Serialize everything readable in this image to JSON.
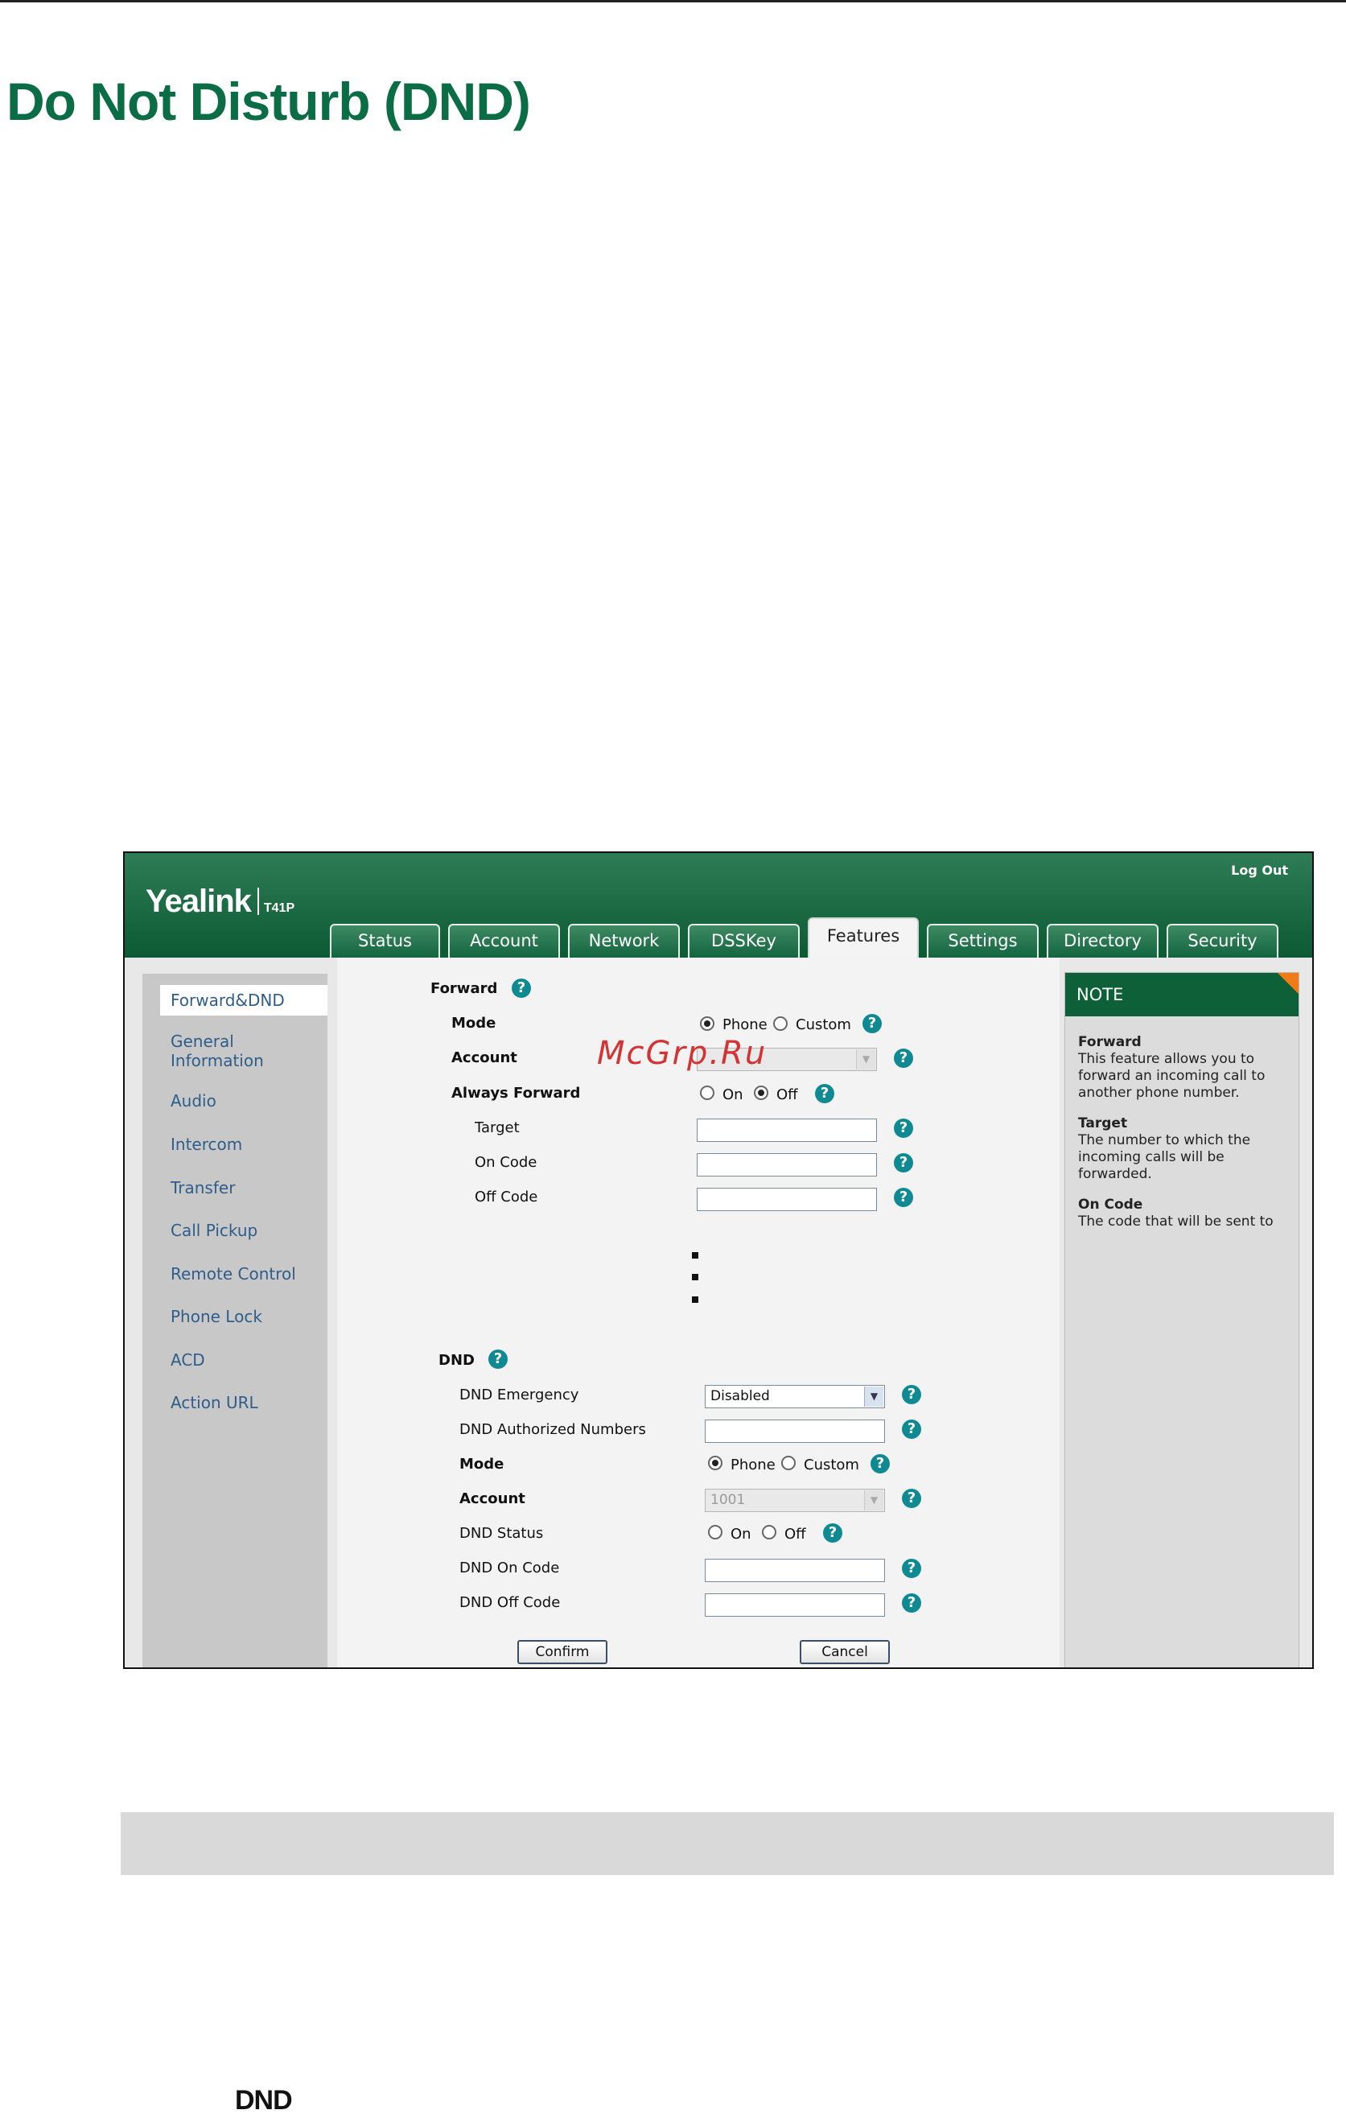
{
  "page": {
    "title": "Do Not Disturb (DND)",
    "bottom_text": "DND"
  },
  "app": {
    "brand": "Yealink",
    "model": "T41P",
    "logout": "Log Out",
    "tabs": [
      "Status",
      "Account",
      "Network",
      "DSSKey",
      "Features",
      "Settings",
      "Directory",
      "Security"
    ],
    "active_tab": "Features"
  },
  "sidebar": {
    "items": [
      "Forward&DND",
      "General Information",
      "Audio",
      "Intercom",
      "Transfer",
      "Call Pickup",
      "Remote Control",
      "Phone Lock",
      "ACD",
      "Action URL"
    ],
    "active": "Forward&DND"
  },
  "forward": {
    "section": "Forward",
    "mode_label": "Mode",
    "mode_phone": "Phone",
    "mode_custom": "Custom",
    "account_label": "Account",
    "always_forward_label": "Always Forward",
    "on": "On",
    "off": "Off",
    "target_label": "Target",
    "on_code_label": "On Code",
    "off_code_label": "Off Code"
  },
  "dnd": {
    "section": "DND",
    "emergency_label": "DND Emergency",
    "emergency_value": "Disabled",
    "authorized_label": "DND Authorized Numbers",
    "mode_label": "Mode",
    "mode_phone": "Phone",
    "mode_custom": "Custom",
    "account_label": "Account",
    "account_value": "1001",
    "status_label": "DND Status",
    "on": "On",
    "off": "Off",
    "on_code_label": "DND On Code",
    "off_code_label": "DND Off Code"
  },
  "buttons": {
    "confirm": "Confirm",
    "cancel": "Cancel"
  },
  "note": {
    "header": "NOTE",
    "forward_title": "Forward",
    "forward_text": "This feature allows you to forward an incoming call to another phone number.",
    "target_title": "Target",
    "target_text": "The number to which the incoming calls will be forwarded.",
    "on_code_title": "On Code",
    "on_code_text": "The code that will be sent to"
  },
  "watermark": "McGrp.Ru",
  "colors": {
    "title_green": "#0b6d45",
    "header_green": "#0c5a34",
    "link_blue": "#2f5d8a",
    "help_teal": "#0f8a93",
    "note_corner": "#f07b17",
    "watermark_red": "#d23434"
  }
}
